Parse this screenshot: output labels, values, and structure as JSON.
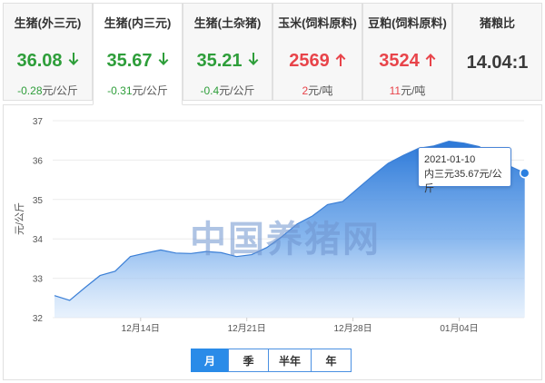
{
  "cards": [
    {
      "title": "生猪(外三元)",
      "price": "36.08",
      "direction": "down",
      "change": "-0.28",
      "unit": "元/公斤",
      "active": false
    },
    {
      "title": "生猪(内三元)",
      "price": "35.67",
      "direction": "down",
      "change": "-0.31",
      "unit": "元/公斤",
      "active": true
    },
    {
      "title": "生猪(土杂猪)",
      "price": "35.21",
      "direction": "down",
      "change": "-0.4",
      "unit": "元/公斤",
      "active": false
    },
    {
      "title": "玉米(饲料原料)",
      "price": "2569",
      "direction": "up",
      "change": "2",
      "unit": "元/吨",
      "active": false
    },
    {
      "title": "豆粕(饲料原料)",
      "price": "3524",
      "direction": "up",
      "change": "11",
      "unit": "元/吨",
      "active": false
    },
    {
      "title": "猪粮比",
      "price": "14.04:1",
      "direction": "flat",
      "change": "",
      "unit": "",
      "active": false
    }
  ],
  "colors": {
    "down": "#2e9e3a",
    "up": "#e8444a",
    "accent": "#2a8be8"
  },
  "icons": {
    "down": "arrow-down-icon",
    "up": "arrow-up-icon"
  },
  "watermark": "中国养猪网",
  "tooltip": {
    "date": "2021-01-10",
    "text": "内三元35.67元/公斤"
  },
  "periods": [
    {
      "label": "月",
      "active": true
    },
    {
      "label": "季",
      "active": false
    },
    {
      "label": "半年",
      "active": false
    },
    {
      "label": "年",
      "active": false
    }
  ],
  "chart_data": {
    "type": "area",
    "title": "",
    "xlabel": "",
    "ylabel": "元/公斤",
    "ylim": [
      32,
      37
    ],
    "yticks": [
      32,
      33,
      34,
      35,
      36,
      37
    ],
    "grid": true,
    "x_tick_labels": [
      {
        "label": "12月14日",
        "index": 4
      },
      {
        "label": "12月21日",
        "index": 11
      },
      {
        "label": "12月28日",
        "index": 18
      },
      {
        "label": "01月04日",
        "index": 25
      }
    ],
    "series": [
      {
        "name": "内三元",
        "x": [
          "12-10",
          "12-11",
          "12-12",
          "12-13",
          "12-14",
          "12-15",
          "12-16",
          "12-17",
          "12-18",
          "12-19",
          "12-20",
          "12-21",
          "12-22",
          "12-23",
          "12-24",
          "12-25",
          "12-26",
          "12-27",
          "12-28",
          "12-29",
          "12-30",
          "12-31",
          "01-01",
          "01-02",
          "01-03",
          "01-04",
          "01-05",
          "01-06",
          "01-07",
          "01-08",
          "01-09",
          "01-10"
        ],
        "values": [
          32.56,
          32.44,
          32.76,
          33.07,
          33.18,
          33.55,
          33.64,
          33.72,
          33.64,
          33.63,
          33.68,
          33.65,
          33.55,
          33.6,
          33.78,
          34.06,
          34.38,
          34.58,
          34.87,
          34.95,
          35.28,
          35.61,
          35.92,
          36.12,
          36.3,
          36.36,
          36.48,
          36.43,
          36.34,
          36.1,
          35.85,
          35.67
        ]
      }
    ],
    "highlight_point": {
      "x": "01-10",
      "value": 35.67
    }
  }
}
